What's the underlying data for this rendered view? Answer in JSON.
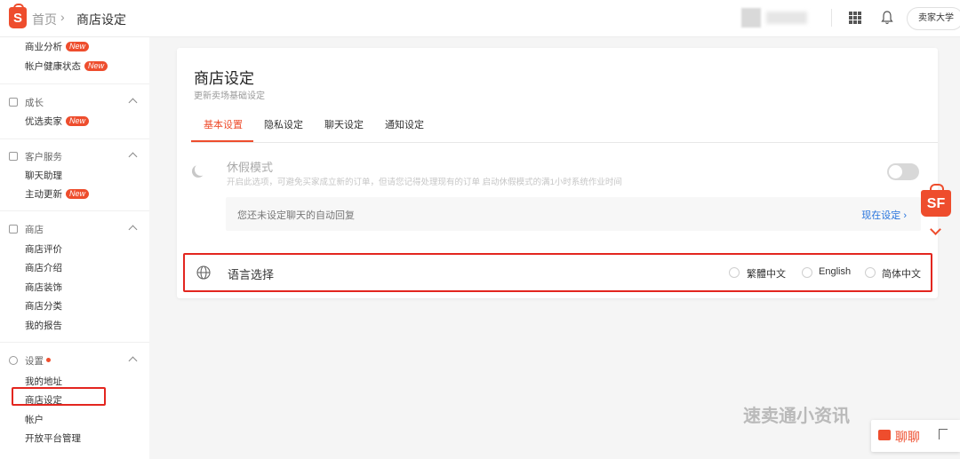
{
  "header": {
    "brand_letter": "S",
    "breadcrumb_home": "首页",
    "breadcrumb_sep": "›",
    "breadcrumb_current": "商店设定",
    "seller_university": "卖家大学"
  },
  "sidebar": {
    "top_items": [
      {
        "label": "商业分析",
        "badge": "New"
      },
      {
        "label": "帐户健康状态",
        "badge": "New"
      }
    ],
    "groups": [
      {
        "title": "成长",
        "items": [
          {
            "label": "优选卖家",
            "badge": "New"
          }
        ]
      },
      {
        "title": "客户服务",
        "items": [
          {
            "label": "聊天助理"
          },
          {
            "label": "主动更新",
            "badge": "New"
          }
        ]
      },
      {
        "title": "商店",
        "items": [
          {
            "label": "商店评价"
          },
          {
            "label": "商店介绍"
          },
          {
            "label": "商店装饰"
          },
          {
            "label": "商店分类"
          },
          {
            "label": "我的报告"
          }
        ]
      },
      {
        "title": "设置",
        "items": [
          {
            "label": "我的地址"
          },
          {
            "label": "商店设定"
          },
          {
            "label": "帐户"
          },
          {
            "label": "开放平台管理"
          }
        ]
      }
    ]
  },
  "main": {
    "title": "商店设定",
    "subtitle": "更新卖场基础设定",
    "tabs": [
      "基本设置",
      "隐私设定",
      "聊天设定",
      "通知设定"
    ],
    "active_tab": "基本设置",
    "vacation": {
      "title": "休假模式",
      "description": "开启此选项，可避免买家成立新的订单，但请您记得处理现有的订单 启动休假模式的满1小时系统作业时间",
      "enabled": false
    },
    "auto_reply": {
      "text": "您还未设定聊天的自动回复",
      "link": "现在设定 ›"
    },
    "language": {
      "label": "语言选择",
      "options": [
        "繁體中文",
        "English",
        "简体中文"
      ]
    }
  },
  "floating": {
    "sf_label": "SF",
    "watermark": "速卖通小资讯",
    "chat_label": "聊聊"
  },
  "colors": {
    "accent": "#ee4d2d",
    "link": "#2673dd",
    "highlight_border": "#e3261f"
  }
}
